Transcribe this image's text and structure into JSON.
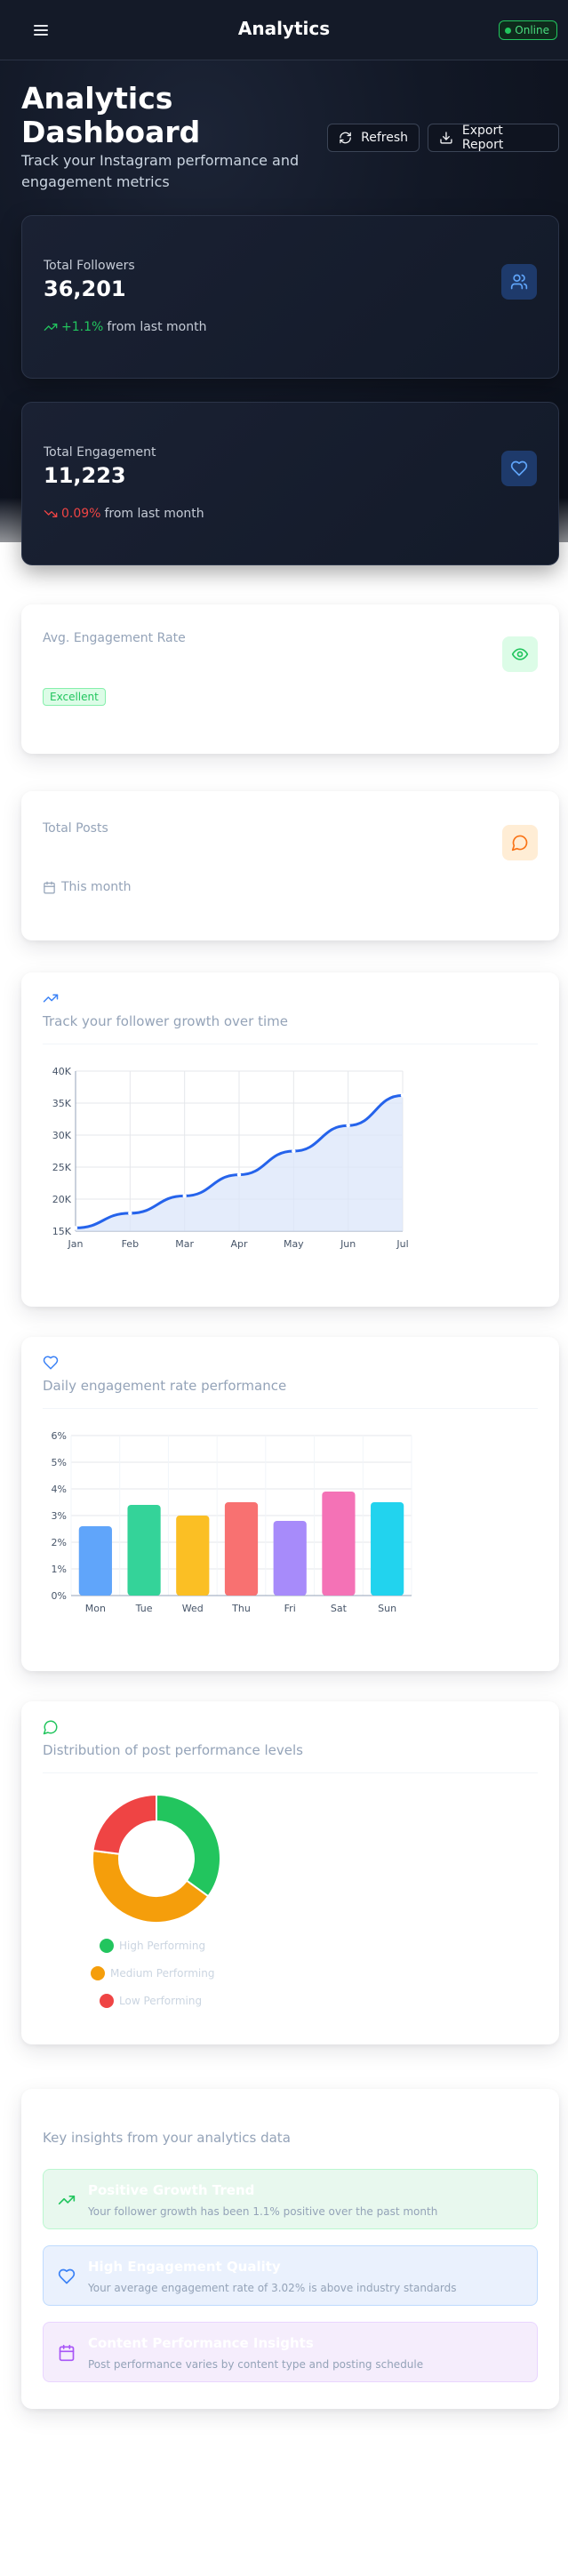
{
  "header": {
    "title": "Analytics",
    "status": "Online"
  },
  "page": {
    "title": "Analytics Dashboard",
    "subtitle": "Track your Instagram performance and engagement metrics",
    "refresh_label": "Refresh",
    "export_label": "Export Report"
  },
  "stats": {
    "followers": {
      "label": "Total Followers",
      "value": "36,201",
      "change": "+1.1%",
      "change_suffix": "from last month",
      "icon": "users-icon"
    },
    "engagement": {
      "label": "Total Engagement",
      "value": "11,223",
      "change": "0.09%",
      "change_suffix": "from last month",
      "icon": "heart-icon"
    },
    "rate": {
      "label": "Avg. Engagement Rate",
      "badge": "Excellent",
      "icon": "eye-icon"
    },
    "posts": {
      "label": "Total Posts",
      "meta": "This month",
      "icon": "message-icon"
    }
  },
  "growth_card": {
    "subtitle": "Track your follower growth over time"
  },
  "engagement_card": {
    "subtitle": "Daily engagement rate performance"
  },
  "performance_card": {
    "subtitle": "Distribution of post performance levels"
  },
  "insights_card": {
    "subtitle": "Key insights from your analytics data",
    "items": [
      {
        "title": "Positive Growth Trend",
        "text": "Your follower growth has been 1.1% positive over the past month",
        "icon": "trending-up-icon"
      },
      {
        "title": "High Engagement Quality",
        "text": "Your average engagement rate of 3.02% is above industry standards",
        "icon": "heart-icon"
      },
      {
        "title": "Content Performance Insights",
        "text": "Post performance varies by content type and posting schedule",
        "icon": "calendar-icon"
      }
    ]
  },
  "colors": {
    "positive": "#22c55e",
    "negative": "#ef4444",
    "line": "#2563eb",
    "high": "#22c55e",
    "medium": "#f59e0b",
    "low": "#ef4444"
  },
  "chart_data": [
    {
      "type": "area",
      "x": [
        "Jan",
        "Feb",
        "Mar",
        "Apr",
        "May",
        "Jun",
        "Jul"
      ],
      "series": [
        {
          "values": [
            15500,
            17800,
            20500,
            23800,
            27500,
            31500,
            36201
          ]
        }
      ],
      "yticks": [
        "15K",
        "20K",
        "25K",
        "30K",
        "35K",
        "40K"
      ],
      "ylim": [
        15000,
        40000
      ],
      "grid": true
    },
    {
      "type": "bar",
      "categories": [
        "Mon",
        "Tue",
        "Wed",
        "Thu",
        "Fri",
        "Sat",
        "Sun"
      ],
      "values": [
        2.6,
        3.4,
        3.0,
        3.5,
        2.8,
        3.9,
        3.5
      ],
      "bar_colors": [
        "#60a5fa",
        "#34d399",
        "#fbbf24",
        "#f87171",
        "#a78bfa",
        "#f472b6",
        "#22d3ee"
      ],
      "yticks": [
        "0%",
        "1%",
        "2%",
        "3%",
        "4%",
        "5%",
        "6%"
      ],
      "ylim": [
        0,
        6
      ],
      "grid": true
    },
    {
      "type": "pie",
      "labels": [
        "High Performing",
        "Medium Performing",
        "Low Performing"
      ],
      "values": [
        35,
        42,
        23
      ],
      "colors": [
        "#22c55e",
        "#f59e0b",
        "#ef4444"
      ]
    }
  ]
}
